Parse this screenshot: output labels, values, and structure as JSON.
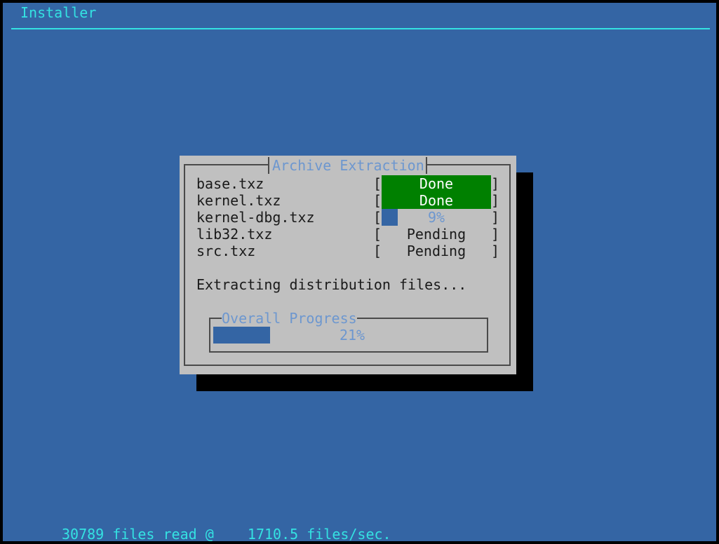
{
  "app": {
    "title": "Installer"
  },
  "dialog": {
    "title": "Archive Extraction",
    "items": [
      {
        "name": "base.txz",
        "status": "Done",
        "percent": 100,
        "state": "done"
      },
      {
        "name": "kernel.txz",
        "status": "Done",
        "percent": 100,
        "state": "done"
      },
      {
        "name": "kernel-dbg.txz",
        "status": "9%",
        "percent": 9,
        "state": "active"
      },
      {
        "name": "lib32.txz",
        "status": "Pending",
        "percent": 0,
        "state": "pending"
      },
      {
        "name": "src.txz",
        "status": "Pending",
        "percent": 0,
        "state": "pending"
      }
    ],
    "bracket_open": "[",
    "bracket_close": "]",
    "message": "Extracting distribution files...",
    "overall": {
      "title": "Overall Progress",
      "percent_label": "21%",
      "percent": 21
    }
  },
  "footer": {
    "status": "30789 files read @    1710.5 files/sec."
  },
  "colors": {
    "background": "#3465a4",
    "accent": "#34e2e2",
    "dialog": "#c0c0c0",
    "done": "#008000",
    "progress": "#3465a4",
    "dim_text": "#6d97cf"
  },
  "icons": {
    "none": "text-mode UI, no icons"
  }
}
